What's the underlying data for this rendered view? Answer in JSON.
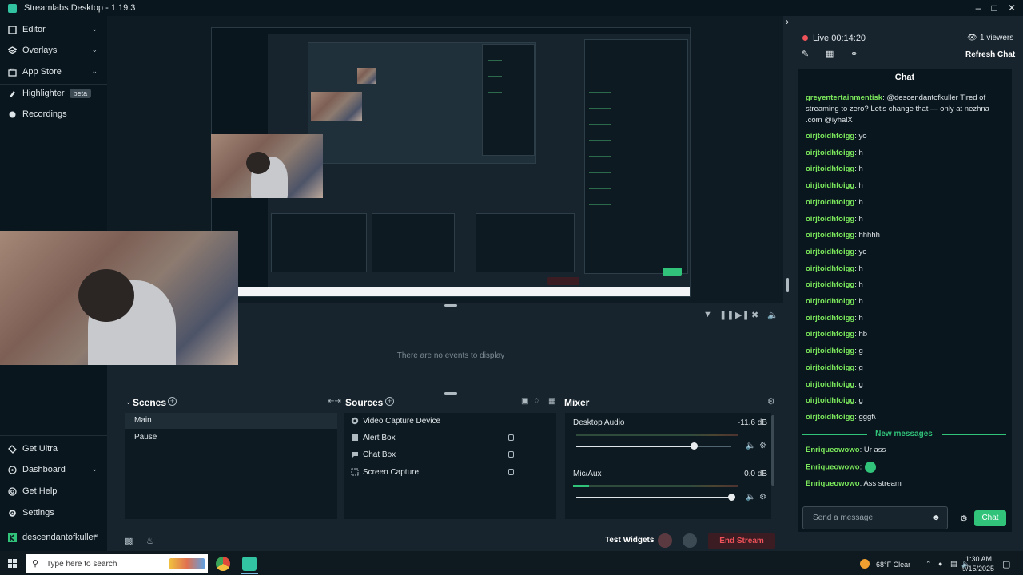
{
  "window": {
    "title": "Streamlabs Desktop - 1.19.3"
  },
  "sidebar": {
    "items": [
      {
        "label": "Editor",
        "icon": "editor-icon"
      },
      {
        "label": "Overlays",
        "icon": "overlays-icon"
      },
      {
        "label": "App Store",
        "icon": "app-store-icon"
      },
      {
        "label": "Highlighter",
        "icon": "highlighter-icon",
        "badge": "beta"
      },
      {
        "label": "Recordings",
        "icon": "record-icon"
      }
    ],
    "bottom_items": [
      {
        "label": "Get Ultra"
      },
      {
        "label": "Dashboard"
      },
      {
        "label": "Get Help"
      },
      {
        "label": "Settings"
      }
    ],
    "user": "descendantofkuller"
  },
  "events": {
    "empty_text": "There are no events to display"
  },
  "scenes": {
    "title": "Scenes",
    "items": [
      "Main",
      "Pause"
    ],
    "active": "Main"
  },
  "sources": {
    "title": "Sources",
    "items": [
      "Video Capture Device",
      "Alert Box",
      "Chat Box",
      "Screen Capture"
    ]
  },
  "mixer": {
    "title": "Mixer",
    "channels": [
      {
        "name": "Desktop Audio",
        "db": "-11.6 dB",
        "level": 0.76
      },
      {
        "name": "Mic/Aux",
        "db": "0.0 dB",
        "level": 1.0
      }
    ]
  },
  "footer": {
    "test_widgets": "Test Widgets",
    "end_stream": "End Stream"
  },
  "stream": {
    "status": "Live 00:14:20",
    "viewers": "1 viewers",
    "refresh_chat": "Refresh Chat"
  },
  "chat": {
    "title": "Chat",
    "messages": [
      {
        "user": "greyentertainmentisk",
        "text": ": @descendantofkuller Tired of streaming to zero? Let's change that — only at nezhna .com @iyhalX"
      },
      {
        "user": "oirjtoidhfoigg",
        "text": ": yo"
      },
      {
        "user": "oirjtoidhfoigg",
        "text": ": h"
      },
      {
        "user": "oirjtoidhfoigg",
        "text": ": h"
      },
      {
        "user": "oirjtoidhfoigg",
        "text": ": h"
      },
      {
        "user": "oirjtoidhfoigg",
        "text": ": h"
      },
      {
        "user": "oirjtoidhfoigg",
        "text": ": h"
      },
      {
        "user": "oirjtoidhfoigg",
        "text": ": hhhhh"
      },
      {
        "user": "oirjtoidhfoigg",
        "text": ": yo"
      },
      {
        "user": "oirjtoidhfoigg",
        "text": ": h"
      },
      {
        "user": "oirjtoidhfoigg",
        "text": ": h"
      },
      {
        "user": "oirjtoidhfoigg",
        "text": ": h"
      },
      {
        "user": "oirjtoidhfoigg",
        "text": ": h"
      },
      {
        "user": "oirjtoidhfoigg",
        "text": ": hb"
      },
      {
        "user": "oirjtoidhfoigg",
        "text": ": g"
      },
      {
        "user": "oirjtoidhfoigg",
        "text": ": g"
      },
      {
        "user": "oirjtoidhfoigg",
        "text": ": g"
      },
      {
        "user": "oirjtoidhfoigg",
        "text": ": g"
      },
      {
        "user": "oirjtoidhfoigg",
        "text": ": gggf\\"
      }
    ],
    "new_messages_label": "New messages",
    "new_messages": [
      {
        "user": "Enriqueowowo",
        "text": ": Ur ass"
      },
      {
        "user": "Enriqueowowo",
        "text": ":"
      },
      {
        "user": "Enriqueowowo",
        "text": ": Ass stream"
      }
    ],
    "input_placeholder": "Send a message",
    "send_label": "Chat"
  },
  "taskbar": {
    "search_placeholder": "Type here to search",
    "weather": "68°F  Clear",
    "time": "1:30 AM",
    "date": "9/15/2025"
  }
}
